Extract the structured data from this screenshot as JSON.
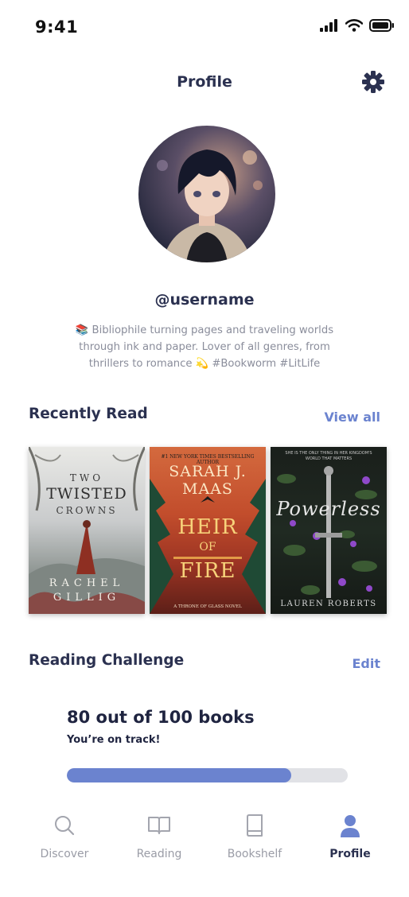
{
  "status_bar": {
    "time": "9:41"
  },
  "header": {
    "title": "Profile",
    "settings_icon": "gear-icon"
  },
  "profile": {
    "username": "@username",
    "bio_lines": [
      "📚 Bibliophile turning pages and traveling worlds",
      "through ink and paper. Lover of all genres, from",
      "thrillers to romance 💫 #Bookworm #LitLife"
    ]
  },
  "recently_read": {
    "title": "Recently Read",
    "view_all_label": "View all",
    "books": [
      {
        "title_line1": "TWO",
        "title_line2": "TWISTED",
        "title_line3": "CROWNS",
        "author_line1": "RACHEL",
        "author_line2": "GILLIG"
      },
      {
        "tagline": "#1 NEW YORK TIMES BESTSELLING AUTHOR",
        "author_line1": "SARAH J.",
        "author_line2": "MAAS",
        "title_line1": "HEIR",
        "title_line2": "OF",
        "title_line3": "FIRE",
        "series": "A THRONE OF GLASS NOVEL"
      },
      {
        "tagline_line1": "SHE IS THE ONLY THING IN HER KINGDOM'S",
        "tagline_line2": "WORLD THAT MATTERS",
        "title": "Powerless",
        "author": "LAUREN ROBERTS"
      }
    ]
  },
  "reading_challenge": {
    "title": "Reading Challenge",
    "edit_label": "Edit",
    "count_text": "80 out of 100 books",
    "status_text": "You’re on track!",
    "progress": 0.8,
    "progress_color": "#6b83cf"
  },
  "tabs": [
    {
      "label": "Discover",
      "icon": "search-icon",
      "active": false
    },
    {
      "label": "Reading",
      "icon": "open-book-icon",
      "active": false
    },
    {
      "label": "Bookshelf",
      "icon": "book-icon",
      "active": false
    },
    {
      "label": "Profile",
      "icon": "user-icon",
      "active": true
    }
  ],
  "colors": {
    "accent": "#6b83cf",
    "text_dark": "#2b3150",
    "muted": "#9a9ca6"
  }
}
